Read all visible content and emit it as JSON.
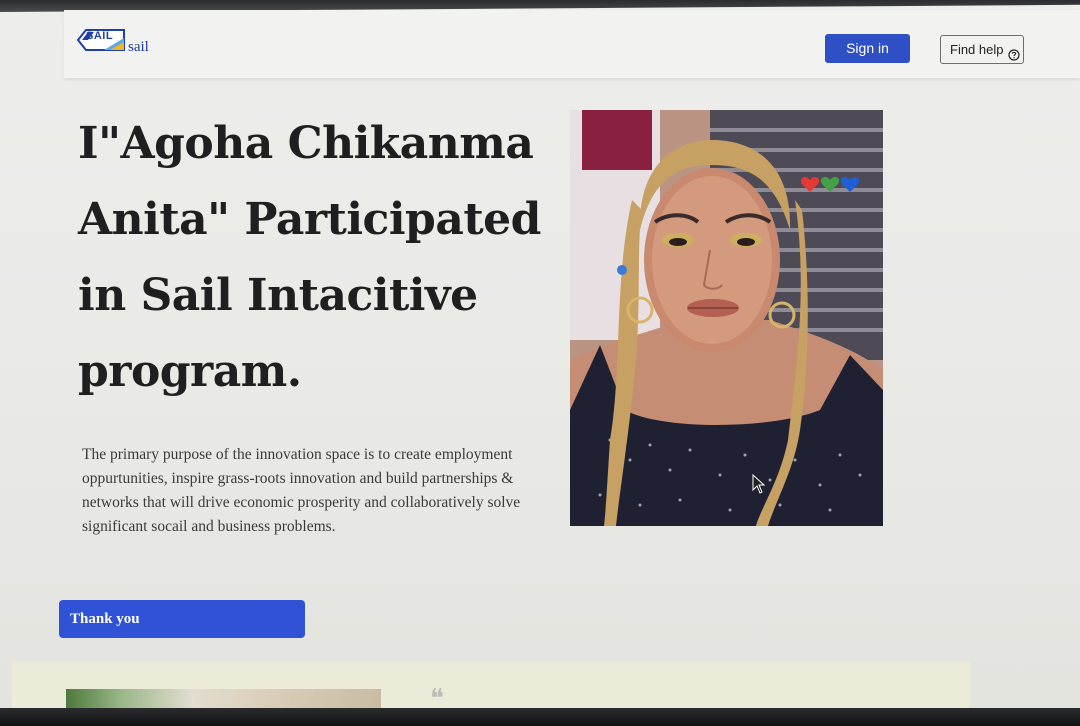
{
  "header": {
    "logo_mark_text": "SAIL",
    "logo_text": "sail",
    "signin_label": "Sign in",
    "help_label": "Find help"
  },
  "hero": {
    "title": "I\"Agoha Chikanma Anita\" Participated in Sail Intacitive program.",
    "description": "The primary purpose of the innovation space is to create employment oppurtunities, inspire grass-roots innovation and build partnerships & networks that will drive economic prosperity and collaboratively solve significant socail and business problems.",
    "button_label": "Thank you"
  },
  "icons": {
    "logo": "sail-logo-icon",
    "help": "question-circle-icon",
    "photo": "portrait-photo",
    "hearts": [
      "red-heart-emoji",
      "green-heart-emoji",
      "blue-heart-emoji"
    ],
    "cursor": "mouse-pointer-icon"
  },
  "colors": {
    "primary": "#2f4fc4",
    "button": "#2f52d6",
    "heading": "#1f1f1f",
    "body_text": "#3a3a3a"
  }
}
